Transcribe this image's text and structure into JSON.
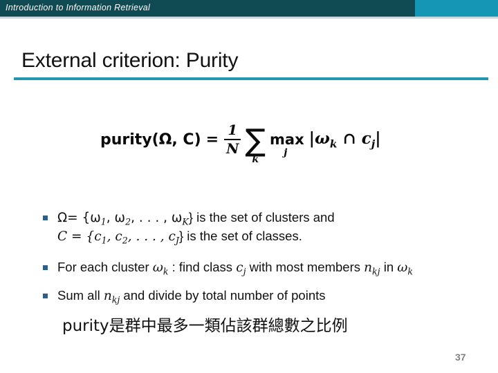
{
  "banner": {
    "title": "Introduction to Information Retrieval",
    "bg_color": "#104a52",
    "accent_color": "#1497b5"
  },
  "slide": {
    "title": "External criterion: Purity",
    "rule_color": "#2196ae",
    "page_number": "37"
  },
  "formula": {
    "plain": "purity(Ω, C) = (1/N) Σ_k max_j |ω_k ∩ c_j|",
    "lhs": "purity(Ω, C)",
    "equals": "=",
    "fraction_numerator": "1",
    "fraction_denominator": "N",
    "sum_symbol": "∑",
    "sum_subscript": "k",
    "max_operator": "max",
    "max_subscript": "j",
    "cardinality": "|ωₖ ∩ cⱼ|",
    "omega_symbol": "ω",
    "omega_subscript": "k",
    "intersection_symbol": "∩",
    "c_symbol": "c",
    "c_subscript": "j",
    "bar": "|"
  },
  "bullets": [
    {
      "marker": "square-bullet",
      "line1_prefix": "Ω= {ω",
      "line1_sub1": "1",
      "line1_mid1": ", ω",
      "line1_sub2": "2",
      "line1_mid2": ", . . . , ω",
      "line1_sub3": "K",
      "line1_suffix": "} is the set of clusters and",
      "line2_prefix": "C = {c",
      "line2_sub1": "1",
      "line2_mid1": ", c",
      "line2_sub2": "2",
      "line2_mid2": ", . . . , c",
      "line2_sub3": "J",
      "line2_suffix": "} is the set of classes.",
      "plain": "Ω= {ω1, ω2, . . . , ωK} is the set of clusters and C = {c1, c2, . . . , cJ} is the set of classes."
    },
    {
      "marker": "square-bullet",
      "p1": "For each cluster ",
      "sym1": "ω",
      "sub1": "k",
      "p2": " : find class ",
      "sym2": "c",
      "sub2": "j",
      "p3": " with most members ",
      "sym3": "n",
      "sub3": "kj",
      "p4": " in ",
      "sym4": "ω",
      "sub4": "k",
      "plain": "For each cluster ωk : find class cj with most members nkj in ωk"
    },
    {
      "marker": "square-bullet",
      "p1": "Sum all ",
      "sym1": "n",
      "sub1": "kj",
      "p2": " and divide by total number of points",
      "plain": "Sum all nkj and divide by total number of points"
    }
  ],
  "cjk_note": {
    "prefix": "purity",
    "text": "是群中最多一類佔該群總數之比例",
    "full": "purity是群中最多一類佔該群總數之比例"
  },
  "colors": {
    "bullet_marker": "#2e5d8a",
    "text": "#111111",
    "page_number": "#808080"
  }
}
